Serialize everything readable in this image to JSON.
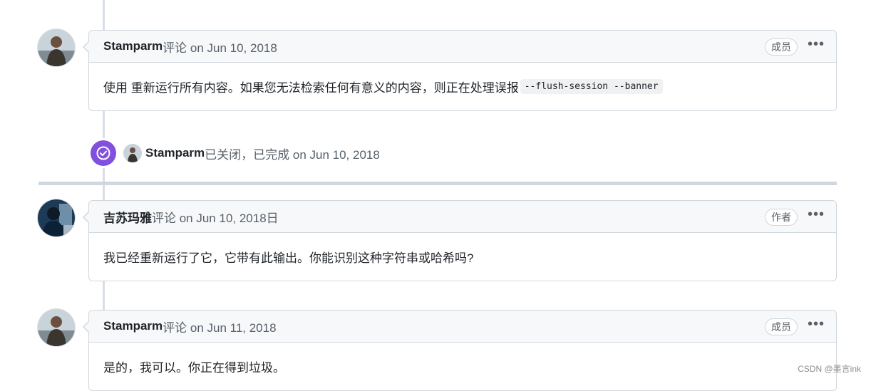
{
  "comments": [
    {
      "author": "Stamparm",
      "action": " 评论 on Jun 10, 2018",
      "role": "成员",
      "menu": "•••",
      "body_text": "使用 重新运行所有内容。如果您无法检索任何有意义的内容，则正在处理误报",
      "body_code": "--flush-session --banner"
    },
    {
      "author": "吉苏玛雅",
      "action": "评论 on Jun 10, 2018日",
      "role": "作者",
      "menu": "•••",
      "body_text": "我已经重新运行了它，它带有此输出。你能识别这种字符串或哈希吗?"
    },
    {
      "author": "Stamparm",
      "action": " 评论 on Jun 11, 2018",
      "role": "成员",
      "menu": "•••",
      "body_text": "是的，我可以。你正在得到垃圾。"
    }
  ],
  "event": {
    "author": "Stamparm",
    "text": " 已关闭，已完成 on Jun 10, 2018",
    "badge_icon": "check-circle-icon",
    "badge_color": "#8250df"
  },
  "watermark": "CSDN @墨言ink"
}
